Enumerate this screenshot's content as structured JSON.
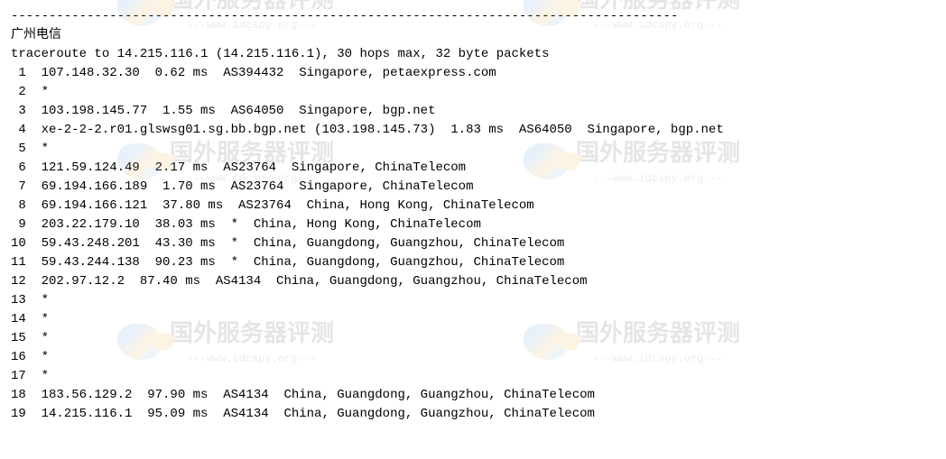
{
  "watermark": {
    "text_cn": "国外服务器评测",
    "url": "---www.idcspy.org---"
  },
  "dashed_line": "----------------------------------------------------------------------------------------",
  "title": "广州电信",
  "trace_header": "traceroute to 14.215.116.1 (14.215.116.1), 30 hops max, 32 byte packets",
  "hops": [
    {
      "num": "1",
      "line": "  107.148.32.30  0.62 ms  AS394432  Singapore, petaexpress.com"
    },
    {
      "num": "2",
      "line": "  *"
    },
    {
      "num": "3",
      "line": "  103.198.145.77  1.55 ms  AS64050  Singapore, bgp.net"
    },
    {
      "num": "4",
      "line": "  xe-2-2-2.r01.glswsg01.sg.bb.bgp.net (103.198.145.73)  1.83 ms  AS64050  Singapore, bgp.net"
    },
    {
      "num": "5",
      "line": "  *"
    },
    {
      "num": "6",
      "line": "  121.59.124.49  2.17 ms  AS23764  Singapore, ChinaTelecom"
    },
    {
      "num": "7",
      "line": "  69.194.166.189  1.70 ms  AS23764  Singapore, ChinaTelecom"
    },
    {
      "num": "8",
      "line": "  69.194.166.121  37.80 ms  AS23764  China, Hong Kong, ChinaTelecom"
    },
    {
      "num": "9",
      "line": "  203.22.179.10  38.03 ms  *  China, Hong Kong, ChinaTelecom"
    },
    {
      "num": "10",
      "line": "  59.43.248.201  43.30 ms  *  China, Guangdong, Guangzhou, ChinaTelecom"
    },
    {
      "num": "11",
      "line": "  59.43.244.138  90.23 ms  *  China, Guangdong, Guangzhou, ChinaTelecom"
    },
    {
      "num": "12",
      "line": "  202.97.12.2  87.40 ms  AS4134  China, Guangdong, Guangzhou, ChinaTelecom"
    },
    {
      "num": "13",
      "line": "  *"
    },
    {
      "num": "14",
      "line": "  *"
    },
    {
      "num": "15",
      "line": "  *"
    },
    {
      "num": "16",
      "line": "  *"
    },
    {
      "num": "17",
      "line": "  *"
    },
    {
      "num": "18",
      "line": "  183.56.129.2  97.90 ms  AS4134  China, Guangdong, Guangzhou, ChinaTelecom"
    },
    {
      "num": "19",
      "line": "  14.215.116.1  95.09 ms  AS4134  China, Guangdong, Guangzhou, ChinaTelecom"
    }
  ]
}
